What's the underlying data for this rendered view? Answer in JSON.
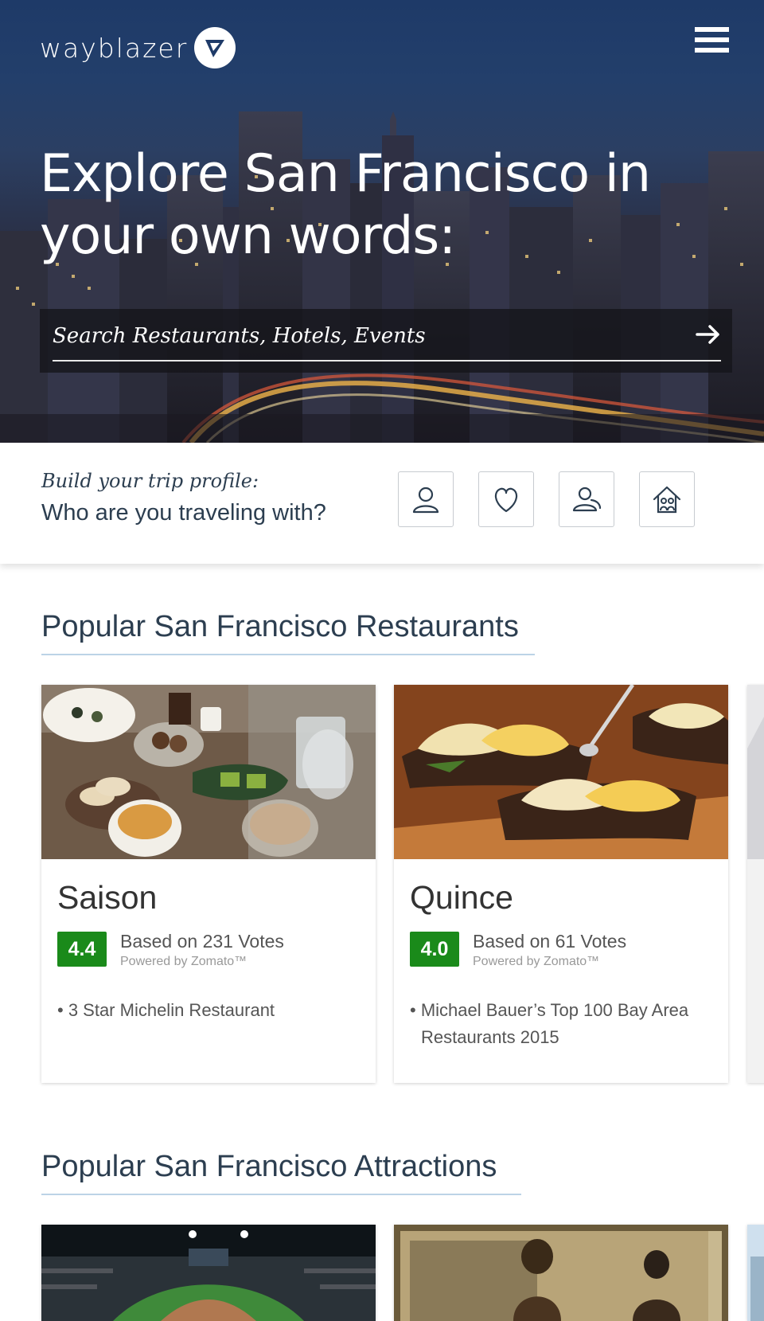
{
  "brand": {
    "name": "wayblazer"
  },
  "hero": {
    "title": "Explore San Francisco in your own words:",
    "search_placeholder": "Search Restaurants, Hotels, Events"
  },
  "profile": {
    "subtitle": "Build your trip profile:",
    "question": "Who are you traveling with?",
    "options": [
      {
        "icon": "person-icon"
      },
      {
        "icon": "heart-icon"
      },
      {
        "icon": "friends-icon"
      },
      {
        "icon": "family-home-icon"
      }
    ]
  },
  "restaurants": {
    "title": "Popular San Francisco Restaurants",
    "items": [
      {
        "name": "Saison",
        "rating": "4.4",
        "votes": "Based on 231 Votes",
        "powered": "Powered by Zomato™",
        "note": "• 3 Star Michelin Restaurant"
      },
      {
        "name": "Quince",
        "rating": "4.0",
        "votes": "Based on 61 Votes",
        "powered": "Powered by Zomato™",
        "note": "• Michael Bauer’s Top 100 Bay Area Restaurants 2015"
      }
    ]
  },
  "attractions": {
    "title": "Popular San Francisco Attractions"
  },
  "colors": {
    "rating_green": "#1a8a1a",
    "heading": "#2c3e50",
    "rule": "#bcd3e6"
  }
}
